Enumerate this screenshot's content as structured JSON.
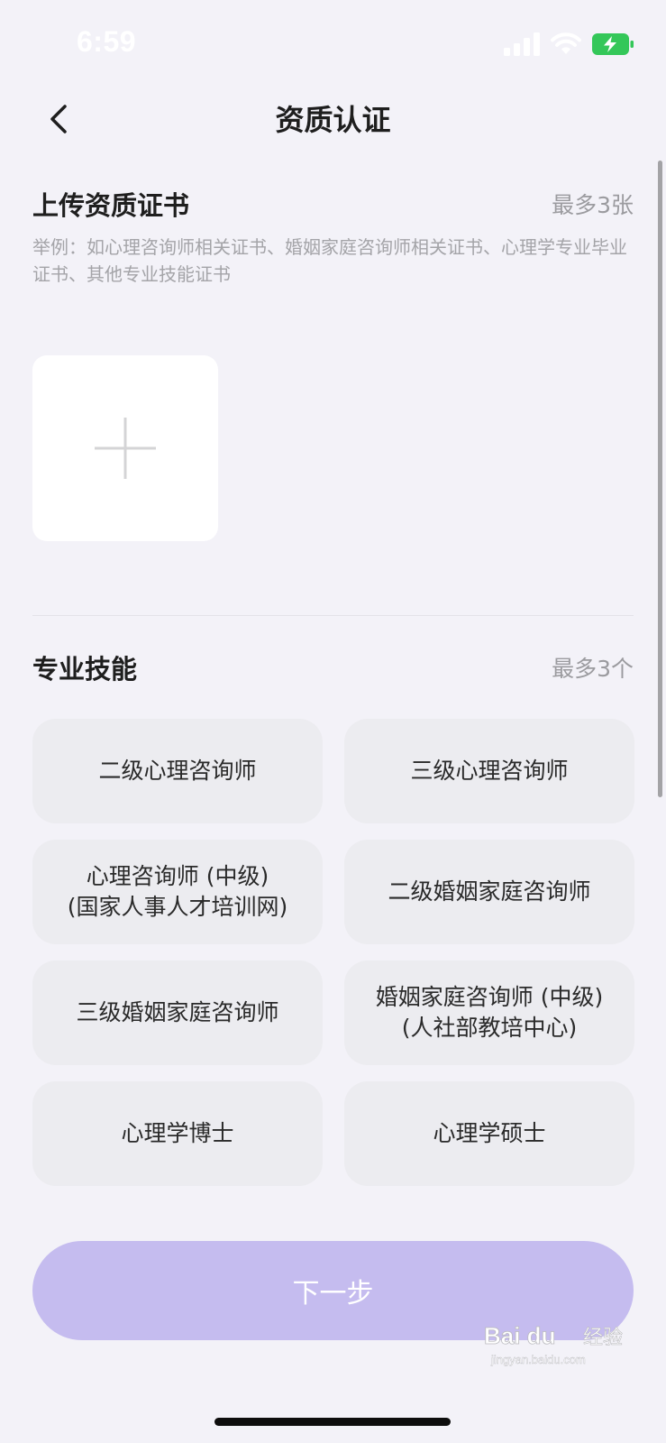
{
  "status_bar": {
    "time": "6:59"
  },
  "nav": {
    "title": "资质认证"
  },
  "certificate_section": {
    "title": "上传资质证书",
    "limit": "最多3张",
    "hint": "举例：如心理咨询师相关证书、婚姻家庭咨询师相关证书、心理学专业毕业证书、其他专业技能证书"
  },
  "skills_section": {
    "title": "专业技能",
    "limit": "最多3个",
    "skills": [
      {
        "line1": "二级心理咨询师",
        "line2": ""
      },
      {
        "line1": "三级心理咨询师",
        "line2": ""
      },
      {
        "line1": "心理咨询师 (中级)",
        "line2": "(国家人事人才培训网)"
      },
      {
        "line1": "二级婚姻家庭咨询师",
        "line2": ""
      },
      {
        "line1": "三级婚姻家庭咨询师",
        "line2": ""
      },
      {
        "line1": "婚姻家庭咨询师 (中级)",
        "line2": "(人社部教培中心)"
      },
      {
        "line1": "心理学博士",
        "line2": ""
      },
      {
        "line1": "心理学硕士",
        "line2": ""
      }
    ]
  },
  "footer": {
    "next_label": "下一步"
  },
  "watermark": {
    "brand": "Bai du",
    "text": "经验",
    "sub": "jingyan.baidu.com"
  },
  "colors": {
    "background": "#f3f2f8",
    "chip": "#ececf0",
    "next_button": "#c5bcef",
    "battery": "#34c759"
  }
}
